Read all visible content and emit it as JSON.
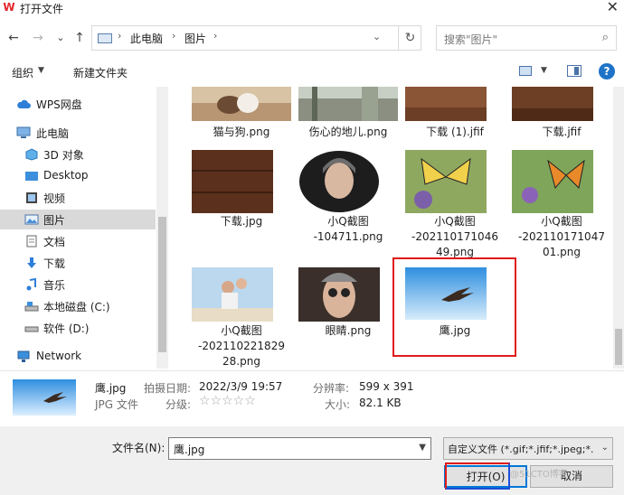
{
  "window": {
    "title": "打开文件",
    "close_glyph": "✕",
    "app_icon_glyph": "W"
  },
  "nav": {
    "back_glyph": "←",
    "forward_glyph": "→",
    "recent_glyph": "⌄",
    "up_glyph": "↑",
    "refresh_glyph": "↻"
  },
  "address": {
    "crumbs": [
      "此电脑",
      "图片"
    ],
    "separator": "›"
  },
  "search": {
    "placeholder": "搜索\"图片\""
  },
  "toolbar": {
    "organize": "组织",
    "new_folder": "新建文件夹",
    "help": "?"
  },
  "sidebar": {
    "items": [
      {
        "label": "WPS网盘",
        "icon": "cloud-icon"
      },
      {
        "label": "此电脑",
        "icon": "computer-icon"
      },
      {
        "label": "3D 对象",
        "icon": "3d-objects-icon"
      },
      {
        "label": "Desktop",
        "icon": "desktop-icon"
      },
      {
        "label": "视频",
        "icon": "video-icon"
      },
      {
        "label": "图片",
        "icon": "pictures-icon",
        "selected": true
      },
      {
        "label": "文档",
        "icon": "documents-icon"
      },
      {
        "label": "下载",
        "icon": "download-icon"
      },
      {
        "label": "音乐",
        "icon": "music-icon"
      },
      {
        "label": "本地磁盘 (C:)",
        "icon": "drive-c-icon"
      },
      {
        "label": "软件 (D:)",
        "icon": "drive-d-icon"
      },
      {
        "label": "Network",
        "icon": "network-icon"
      }
    ]
  },
  "files": [
    {
      "name": "猫与狗.png"
    },
    {
      "name": "伤心的地儿.png"
    },
    {
      "name": "下载 (1).jfif"
    },
    {
      "name": "下载.jfif"
    },
    {
      "name": "下载.jpg"
    },
    {
      "name": "小Q截图-104711.png"
    },
    {
      "name": "小Q截图-20211017104649.png"
    },
    {
      "name": "小Q截图-20211017104701.png"
    },
    {
      "name": "小Q截图-20211022182928.png"
    },
    {
      "name": "眼睛.png"
    },
    {
      "name": "鹰.jpg",
      "selected": true
    }
  ],
  "file_lines": {
    "f5": [
      "小Q截图",
      "-104711.png"
    ],
    "f6": [
      "小Q截图",
      "-202110171046",
      "49.png"
    ],
    "f7": [
      "小Q截图",
      "-202110171047",
      "01.png"
    ],
    "f8": [
      "小Q截图",
      "-202110221829",
      "28.png"
    ]
  },
  "details": {
    "name": "鹰.jpg",
    "type": "JPG 文件",
    "date_key": "拍摄日期:",
    "date_value": "2022/3/9 19:57",
    "rating_key": "分级:",
    "rating_stars": "☆☆☆☆☆",
    "resolution_key": "分辨率:",
    "resolution_value": "599 x 391",
    "size_key": "大小:",
    "size_value": "82.1 KB"
  },
  "footer": {
    "filename_label": "文件名(N):",
    "filename_value": "鹰.jpg",
    "filter_value": "自定义文件 (*.gif;*.jfif;*.jpeg;*.",
    "open_label": "打开(O)",
    "cancel_label": "取消",
    "watermark": "@51CTO博客"
  },
  "colors": {
    "accent": "#0078d7",
    "highlight": "#cce8ff",
    "annotation_red": "#e01a1a"
  }
}
